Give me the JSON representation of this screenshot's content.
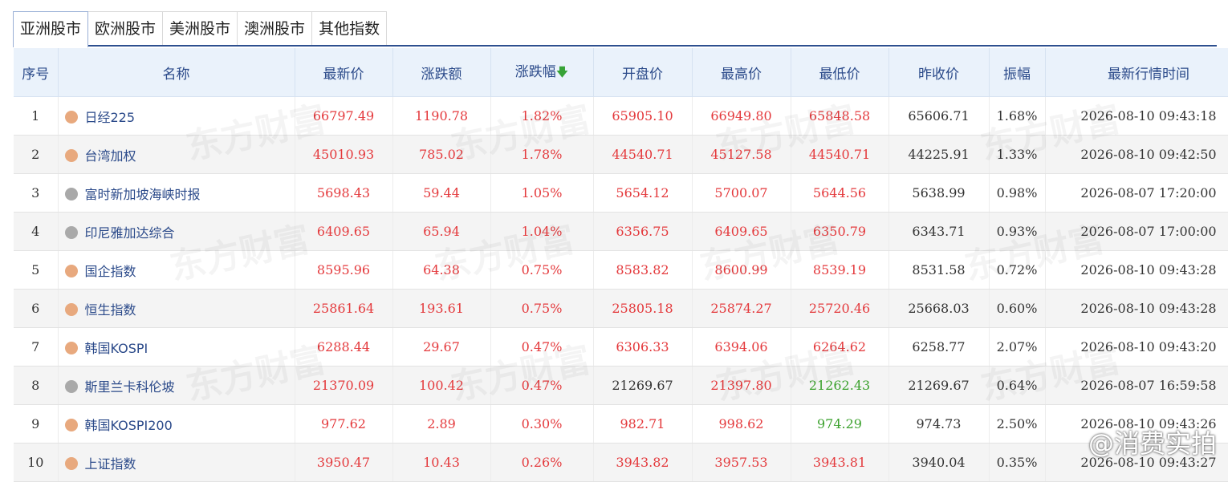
{
  "tabs": [
    "亚洲股市",
    "欧洲股市",
    "美洲股市",
    "澳洲股市",
    "其他指数"
  ],
  "active_tab": 0,
  "columns": [
    "序号",
    "名称",
    "最新价",
    "涨跌额",
    "涨跌幅",
    "开盘价",
    "最高价",
    "最低价",
    "昨收价",
    "振幅",
    "最新行情时间"
  ],
  "sort_indicator_icon": "arrow-down-icon",
  "colors": {
    "up": "#e4393c",
    "down": "#3aa12c",
    "flat": "#333333",
    "open_dot": "#e8a97e",
    "closed_dot": "#a9a9a9"
  },
  "rows": [
    {
      "no": "1",
      "name": "日经225",
      "status": "open",
      "last": "66797.49",
      "chg": "1190.78",
      "pct": "1.82%",
      "open": "65905.10",
      "high": "66949.80",
      "low": "65848.58",
      "prev": "65606.71",
      "amp": "1.68%",
      "time": "2026-08-10 09:43:18",
      "c": {
        "open": "red",
        "low": "red"
      }
    },
    {
      "no": "2",
      "name": "台湾加权",
      "status": "open",
      "last": "45010.93",
      "chg": "785.02",
      "pct": "1.78%",
      "open": "44540.71",
      "high": "45127.58",
      "low": "44540.71",
      "prev": "44225.91",
      "amp": "1.33%",
      "time": "2026-08-10 09:42:50",
      "c": {
        "open": "red",
        "low": "red"
      }
    },
    {
      "no": "3",
      "name": "富时新加坡海峡时报",
      "status": "closed",
      "last": "5698.43",
      "chg": "59.44",
      "pct": "1.05%",
      "open": "5654.12",
      "high": "5700.07",
      "low": "5644.56",
      "prev": "5638.99",
      "amp": "0.98%",
      "time": "2026-08-07 17:20:00",
      "c": {
        "open": "red",
        "low": "red"
      }
    },
    {
      "no": "4",
      "name": "印尼雅加达综合",
      "status": "closed",
      "last": "6409.65",
      "chg": "65.94",
      "pct": "1.04%",
      "open": "6356.75",
      "high": "6409.65",
      "low": "6350.79",
      "prev": "6343.71",
      "amp": "0.93%",
      "time": "2026-08-07 17:00:00",
      "c": {
        "open": "red",
        "low": "red"
      }
    },
    {
      "no": "5",
      "name": "国企指数",
      "status": "open",
      "last": "8595.96",
      "chg": "64.38",
      "pct": "0.75%",
      "open": "8583.82",
      "high": "8600.99",
      "low": "8539.19",
      "prev": "8531.58",
      "amp": "0.72%",
      "time": "2026-08-10 09:43:28",
      "c": {
        "open": "red",
        "low": "red"
      }
    },
    {
      "no": "6",
      "name": "恒生指数",
      "status": "open",
      "last": "25861.64",
      "chg": "193.61",
      "pct": "0.75%",
      "open": "25805.18",
      "high": "25874.27",
      "low": "25720.46",
      "prev": "25668.03",
      "amp": "0.60%",
      "time": "2026-08-10 09:43:28",
      "c": {
        "open": "red",
        "low": "red"
      }
    },
    {
      "no": "7",
      "name": "韩国KOSPI",
      "status": "open",
      "last": "6288.44",
      "chg": "29.67",
      "pct": "0.47%",
      "open": "6306.33",
      "high": "6394.06",
      "low": "6264.62",
      "prev": "6258.77",
      "amp": "2.07%",
      "time": "2026-08-10 09:43:20",
      "c": {
        "open": "red",
        "low": "red"
      }
    },
    {
      "no": "8",
      "name": "斯里兰卡科伦坡",
      "status": "closed",
      "last": "21370.09",
      "chg": "100.42",
      "pct": "0.47%",
      "open": "21269.67",
      "high": "21397.80",
      "low": "21262.43",
      "prev": "21269.67",
      "amp": "0.64%",
      "time": "2026-08-07 16:59:58",
      "c": {
        "open": "black",
        "low": "green"
      }
    },
    {
      "no": "9",
      "name": "韩国KOSPI200",
      "status": "open",
      "last": "977.62",
      "chg": "2.89",
      "pct": "0.30%",
      "open": "982.71",
      "high": "998.62",
      "low": "974.29",
      "prev": "974.73",
      "amp": "2.50%",
      "time": "2026-08-10 09:43:26",
      "c": {
        "open": "red",
        "low": "green"
      }
    },
    {
      "no": "10",
      "name": "上证指数",
      "status": "open",
      "last": "3950.47",
      "chg": "10.43",
      "pct": "0.26%",
      "open": "3943.82",
      "high": "3957.53",
      "low": "3943.81",
      "prev": "3940.04",
      "amp": "0.35%",
      "time": "2026-08-10 09:43:27",
      "c": {
        "open": "red",
        "low": "red"
      }
    }
  ],
  "watermark_text": "东方财富",
  "overlay_text": "@消费实拍"
}
